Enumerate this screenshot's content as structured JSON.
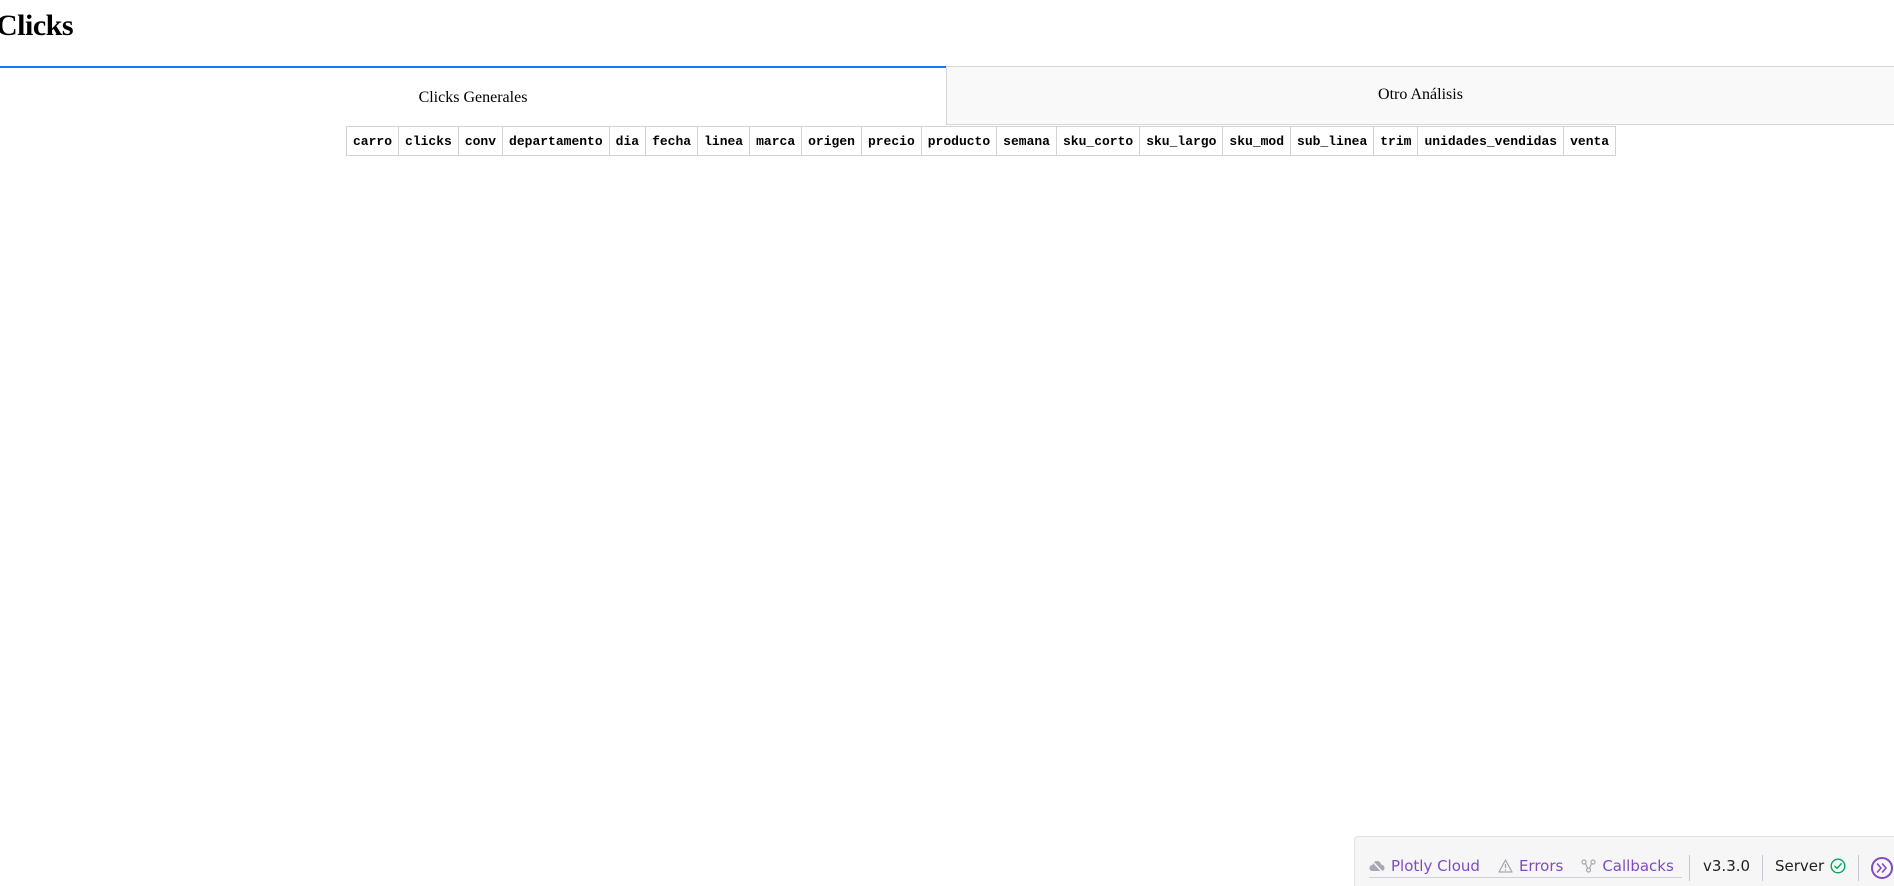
{
  "page": {
    "title": "Clicks"
  },
  "tabs": [
    {
      "label": "Clicks Generales",
      "selected": true
    },
    {
      "label": "Otro Análisis",
      "selected": false
    }
  ],
  "table": {
    "columns": [
      "carro",
      "clicks",
      "conv",
      "departamento",
      "dia",
      "fecha",
      "linea",
      "marca",
      "origen",
      "precio",
      "producto",
      "semana",
      "sku_corto",
      "sku_largo",
      "sku_mod",
      "sub_linea",
      "trim",
      "unidades_vendidas",
      "venta"
    ]
  },
  "debug_bar": {
    "plotly_cloud_label": "Plotly Cloud",
    "errors_label": "Errors",
    "callbacks_label": "Callbacks",
    "version": "v3.3.0",
    "server_label": "Server",
    "accent_color": "#7f4bc4",
    "server_status_color": "#00a65a"
  },
  "colors": {
    "selected_tab_border": "#1975FA",
    "unselected_tab_bg": "#f9f9f9"
  }
}
